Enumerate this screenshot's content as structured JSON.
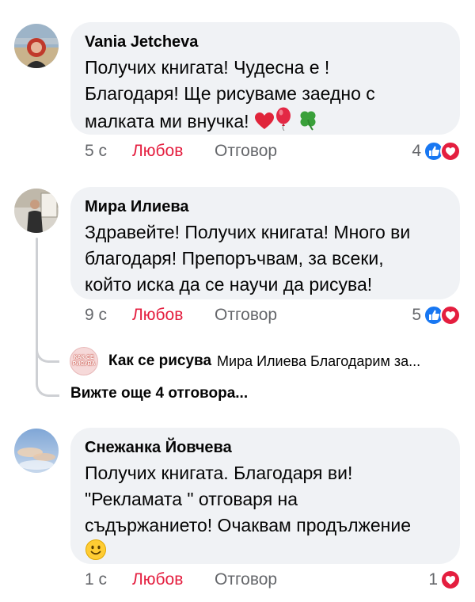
{
  "comments": [
    {
      "author": "Vania Jetcheva",
      "lines": [
        "Получих книгата! Чудесна е !",
        "Благодаря! Ще рисуваме заедно с",
        "малката ми внучка! "
      ],
      "emoji": [
        "red-heart",
        "balloon",
        "four-leaf-clover"
      ],
      "time": "5 с",
      "like_label": "Любов",
      "reply_label": "Отговор",
      "reaction_count": "4",
      "reactions": [
        "like",
        "love"
      ]
    },
    {
      "author": "Мира Илиева",
      "lines": [
        "Здравейте! Получих книгата! Много ви",
        "благодаря! Препоръчвам, за всеки,",
        "който иска да се научи да рисува!"
      ],
      "time": "9 с",
      "like_label": "Любов",
      "reply_label": "Отговор",
      "reaction_count": "5",
      "reactions": [
        "like",
        "love"
      ]
    },
    {
      "author": "Снежанка Йовчева",
      "lines": [
        "Получих книгата. Благодаря ви!",
        "\"Рекламата \" отговаря на",
        "съдържанието! Очаквам продължение"
      ],
      "emoji": [
        "slightly-smiling-face"
      ],
      "time": "1 с",
      "like_label": "Любов",
      "reply_label": "Отговор",
      "reaction_count": "1",
      "reactions": [
        "love"
      ]
    }
  ],
  "reply_preview": {
    "avatar_text": [
      "КАК СЕ",
      "РИСУВА"
    ],
    "name": "Как се рисува",
    "snippet": "Мира Илиева Благодарим за..."
  },
  "more_replies_label": "Вижте още 4 отговора...",
  "colors": {
    "bubble": "#f0f2f5",
    "love_red": "#e41e3f",
    "like_blue": "#1877f2",
    "muted": "#65676b",
    "thread": "#ced0d4"
  }
}
